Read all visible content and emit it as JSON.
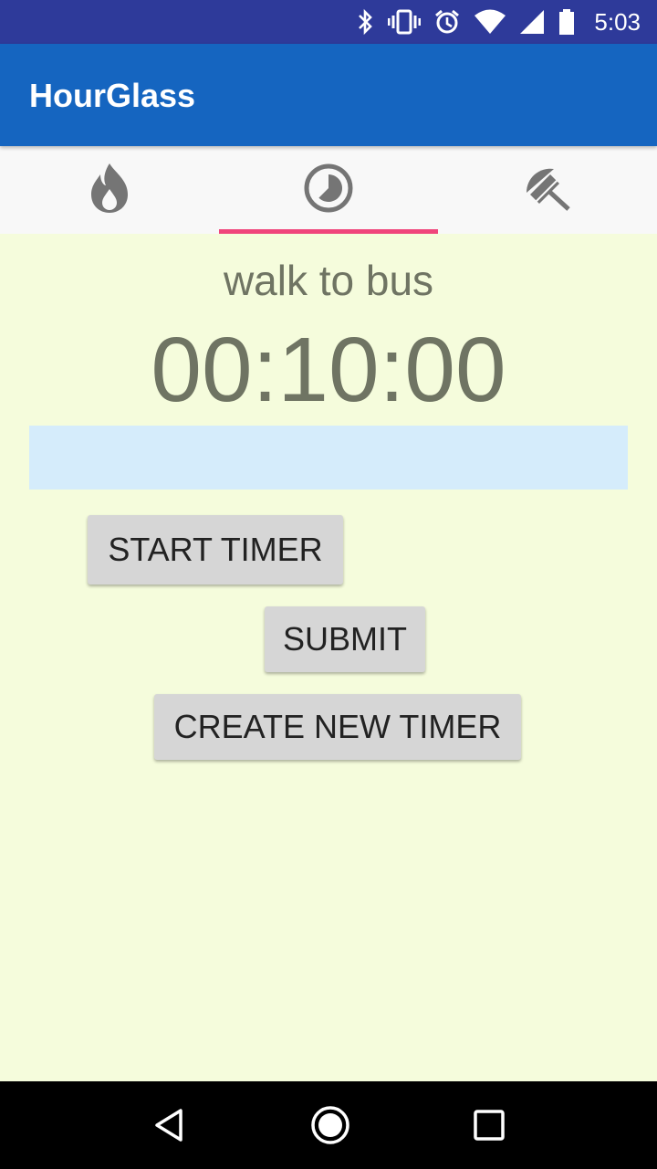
{
  "status_bar": {
    "time": "5:03",
    "icons": [
      "bluetooth-icon",
      "vibrate-icon",
      "alarm-icon",
      "wifi-icon",
      "cell-signal-icon",
      "battery-icon"
    ]
  },
  "app": {
    "title": "HourGlass",
    "colors": {
      "status_bar": "#2e3a9a",
      "app_bar": "#1565c0",
      "tab_indicator": "#f0457b",
      "background": "#f5fcdc",
      "input_bg": "#d5ecfb",
      "timer_text": "#6f7463"
    }
  },
  "tabs": [
    {
      "icon": "flame-icon",
      "active": false
    },
    {
      "icon": "timer-pie-icon",
      "active": true
    },
    {
      "icon": "umbrella-icon",
      "active": false
    }
  ],
  "timer": {
    "name": "walk to bus",
    "value": "00:10:00"
  },
  "input": {
    "value": "",
    "placeholder": ""
  },
  "buttons": {
    "start": "START TIMER",
    "submit": "SUBMIT",
    "create": "CREATE NEW TIMER"
  },
  "nav": {
    "icons": [
      "back-icon",
      "home-icon",
      "recents-icon"
    ]
  }
}
